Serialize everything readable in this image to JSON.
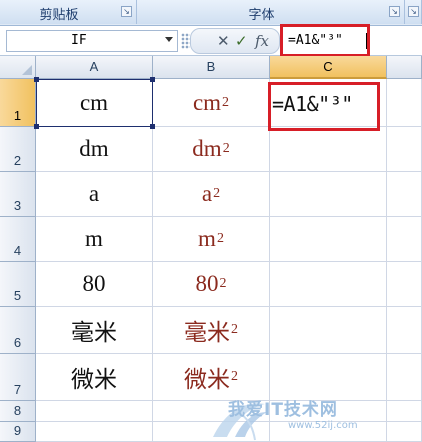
{
  "ribbon": {
    "groups": [
      {
        "label": "剪贴板",
        "launcher": "↘"
      },
      {
        "label": "字体",
        "launcher": "↘"
      },
      {
        "label": "",
        "launcher": "↘"
      }
    ]
  },
  "formula_bar": {
    "name_box": "IF",
    "cancel_icon": "✕",
    "enter_icon": "✓",
    "fx_label": "fx",
    "formula": "=A1&\"³\""
  },
  "columns": [
    "A",
    "B",
    "C"
  ],
  "rows": [
    {
      "num": "1",
      "a": "cm",
      "b": "cm",
      "b_sup": "2"
    },
    {
      "num": "2",
      "a": "dm",
      "b": "dm",
      "b_sup": "2"
    },
    {
      "num": "3",
      "a": "a",
      "b": "a",
      "b_sup": "2"
    },
    {
      "num": "4",
      "a": "m",
      "b": "m",
      "b_sup": "2"
    },
    {
      "num": "5",
      "a": "80",
      "b": "80",
      "b_sup": "2"
    },
    {
      "num": "6",
      "a": "毫米",
      "b": "毫米",
      "b_sup": "2"
    },
    {
      "num": "7",
      "a": "微米",
      "b": "微米",
      "b_sup": "2"
    },
    {
      "num": "8",
      "a": "",
      "b": "",
      "b_sup": ""
    },
    {
      "num": "9",
      "a": "",
      "b": "",
      "b_sup": ""
    }
  ],
  "c1_editing_text": "=A1&\"³\"",
  "watermark": {
    "title": "我爱IT技术网",
    "url": "www.52ij.com"
  },
  "colors": {
    "accent_red": "#d71e27",
    "col_b_text": "#8b2a1e",
    "selected_header": "#f1c15f"
  }
}
